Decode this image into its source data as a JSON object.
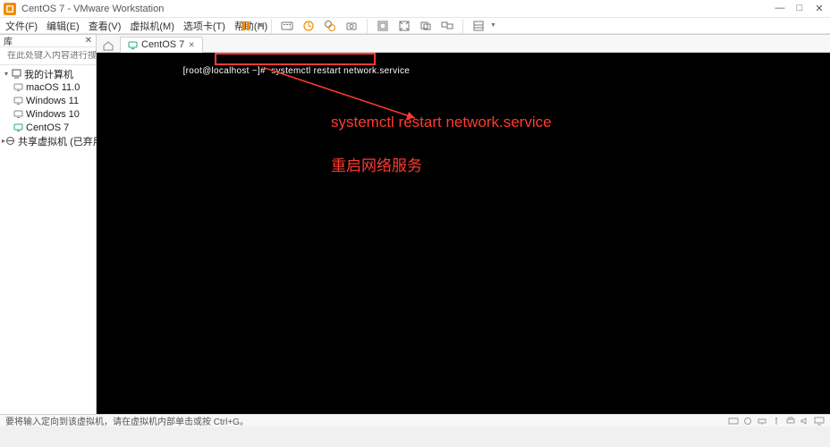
{
  "window": {
    "title": "CentOS 7 - VMware Workstation",
    "controls": {
      "min": "—",
      "max": "□",
      "close": "✕"
    }
  },
  "menu": {
    "file": "文件(F)",
    "edit": "编辑(E)",
    "view": "查看(V)",
    "vm": "虚拟机(M)",
    "tabs": "选项卡(T)",
    "help": "帮助(H)"
  },
  "toolbar_icons": {
    "pause": "pause",
    "power": "power",
    "restart": "restart",
    "suspend": "suspend",
    "snapshot": "snapshot",
    "screenshot": "screenshot",
    "fullscreen": "fullscreen",
    "unity": "unity",
    "multi_mon": "multi_mon",
    "library": "library"
  },
  "sidebar": {
    "header": "库",
    "close": "✕",
    "search_placeholder": "在此处键入内容进行搜索",
    "items": [
      {
        "label": "我的计算机",
        "type": "root",
        "expanded": true
      },
      {
        "label": "macOS 11.0",
        "type": "vm"
      },
      {
        "label": "Windows 11",
        "type": "vm"
      },
      {
        "label": "Windows 10",
        "type": "vm"
      },
      {
        "label": "CentOS 7",
        "type": "vm"
      },
      {
        "label": "共享虚拟机 (已弃用)",
        "type": "root",
        "expanded": false
      }
    ]
  },
  "tab": {
    "label": "CentOS 7",
    "close": "✕"
  },
  "terminal": {
    "prompt": "[root@localhost ~]#",
    "command": "systemctl restart network.service"
  },
  "annotations": {
    "line1": "systemctl restart network.service",
    "line2": "重启网络服务"
  },
  "statusbar": {
    "text": "要将输入定向到该虚拟机，请在虚拟机内部单击或按 Ctrl+G。"
  },
  "colors": {
    "accent_red": "#ff3b30",
    "accent_orange": "#f38b00"
  }
}
